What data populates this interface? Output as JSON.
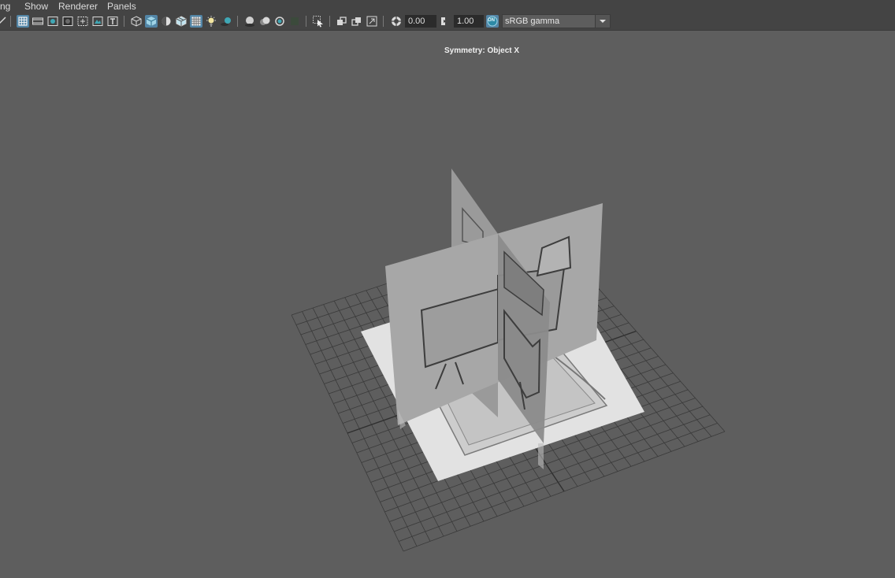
{
  "menubar": {
    "items": [
      {
        "label": "ng"
      },
      {
        "label": "Show"
      },
      {
        "label": "Renderer"
      },
      {
        "label": "Panels"
      }
    ]
  },
  "toolbar": {
    "exposure_value": "0.00",
    "gamma_value": "1.00",
    "color_management_toggle": "ON",
    "color_space": "sRGB gamma",
    "icons": [
      "select-camera-icon",
      "camera-attributes-icon",
      "bookmark-icon",
      "image-plane-icon",
      "grid-icon",
      "film-gate-icon",
      "resolution-gate-icon",
      "gate-mask-icon",
      "field-chart-icon",
      "safe-action-icon",
      "safe-title-icon",
      "wireframe-icon",
      "smooth-shade-icon",
      "default-material-icon",
      "wireframe-on-shaded-icon",
      "xray-icon",
      "use-all-lights-icon",
      "shadows-icon",
      "screen-space-ao-icon",
      "motion-blur-icon",
      "multisample-aa-icon",
      "depth-of-field-icon",
      "isolate-select-icon",
      "xray-joints-icon",
      "xray-active-components-icon",
      "exposure-icon",
      "gamma-icon",
      "color-management-icon"
    ]
  },
  "viewport": {
    "heads_up_display": "Symmetry: Object X"
  },
  "colors": {
    "ui_bar": "#444444",
    "viewport_background": "#5e5e5e",
    "active_toggle": "#5285a6",
    "grid_line": "#3a3a3a"
  }
}
